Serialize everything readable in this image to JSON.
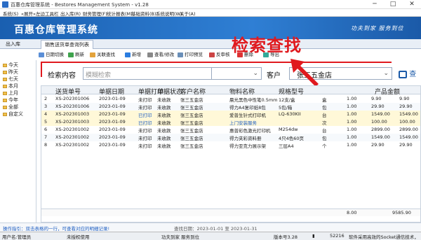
{
  "window": {
    "title": "百惠仓库管理系统 - Bestores Management System - v1.28"
  },
  "menu": [
    "系统(S)",
    "«展开»左边工具栏",
    "出入库(R)",
    "财务管理(F)",
    "统计报表(M)",
    "基础资料(B)",
    "系统说明(W)",
    "关于(A)"
  ],
  "header": {
    "title": "百惠仓库管理系统",
    "slogan": "功夫到家 服务到位"
  },
  "tabs": {
    "home": "出入库",
    "active": "销售送货单查询列表"
  },
  "toolbar": {
    "date_switch": "日期切换",
    "refresh": "刷新",
    "related": "关联查找",
    "add": "新增",
    "view_edit": "查看/修改",
    "print_preview": "打印预览",
    "reverse": "反审核",
    "del": "删除",
    "export": "导出"
  },
  "tree": [
    "今天",
    "昨天",
    "七天",
    "本月",
    "上月",
    "今年",
    "全部",
    "自定义"
  ],
  "filter": {
    "label": "检索内容",
    "placeholder": "模糊检索",
    "select2": "",
    "customer_label": "客户",
    "customer_value": "张三五金店",
    "search_btn": "查"
  },
  "annotation": "检索查找",
  "grid": {
    "headers": [
      "送货单号",
      "单据日期",
      "单据打印",
      "单据状态",
      "客户名称",
      "物料名称",
      "规格型号",
      "",
      "",
      "",
      "",
      "产品金额"
    ],
    "rows": [
      [
        "2",
        "XS-202301006",
        "2023-01-09",
        "未打印",
        "未收款",
        "张三五金店",
        "晨光黑色中性笔0.5mm",
        "12支/盒",
        "盒",
        "1.00",
        "9.90",
        "9.90"
      ],
      [
        "3",
        "XS-202301006",
        "2023-01-09",
        "未打印",
        "未收款",
        "张三五金店",
        "得力A4复印纸8包",
        "5包/箱",
        "包",
        "1.00",
        "29.90",
        "29.90"
      ],
      [
        "4",
        "XS-202301003",
        "2023-01-09",
        "已打印",
        "未收款",
        "张三五金店",
        "爱普生针式打印机",
        "LQ-630KII",
        "台",
        "1.00",
        "1549.00",
        "1549.00"
      ],
      [
        "5",
        "XS-202301003",
        "2023-01-09",
        "已打印",
        "未收款",
        "张三五金店",
        "上门安装服务",
        "",
        "次",
        "1.00",
        "100.00",
        "100.00"
      ],
      [
        "6",
        "XS-202301002",
        "2023-01-09",
        "未打印",
        "未收款",
        "张三五金店",
        "惠普彩色激光打印机",
        "M254dw",
        "台",
        "1.00",
        "2899.00",
        "2899.00"
      ],
      [
        "7",
        "XS-202301002",
        "2023-01-09",
        "未打印",
        "未收款",
        "张三五金店",
        "得力夹彩资料册",
        "4只4色60页",
        "包",
        "1.00",
        "1549.00",
        "1549.00"
      ],
      [
        "8",
        "XS-202301002",
        "2023-01-09",
        "未打印",
        "未收款",
        "张三五金店",
        "得力亚克力展示架",
        "三层A4",
        "个",
        "1.00",
        "29.90",
        "29.90"
      ]
    ],
    "total_qty": "8.00",
    "total_amount": "9585.90"
  },
  "footer": {
    "tip": "操作指引：双击表格的一行，可查看对应的明细记录!",
    "range": "查找日期：2023-01-01 至 2023-01-31"
  },
  "status": {
    "user": "用户名:管理员",
    "auth": "未授权使用",
    "service": "功夫到家 服务到位",
    "version": "版本号3.28",
    "port": "52216",
    "socket": "软件采用高效的Socket通信技术，"
  }
}
